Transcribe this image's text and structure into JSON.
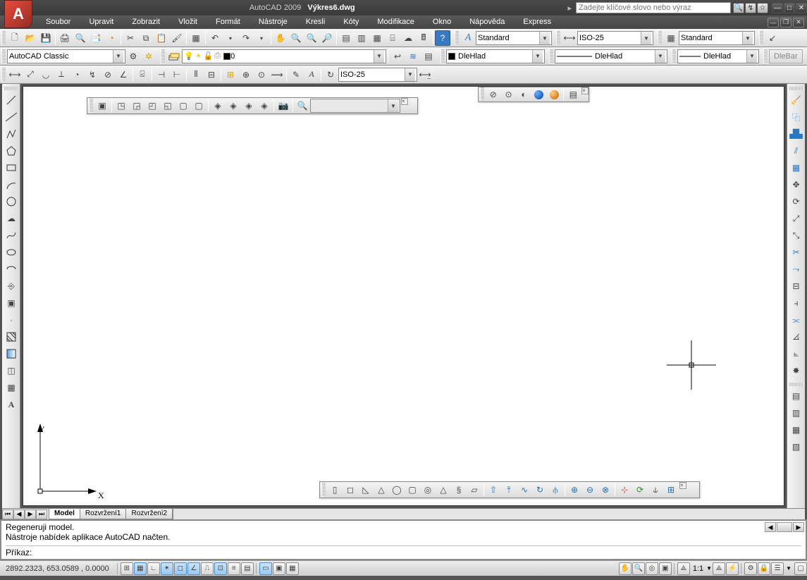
{
  "title": {
    "app": "AutoCAD 2009",
    "doc": "Výkres6.dwg"
  },
  "search_placeholder": "Zadejte klíčové slovo nebo výraz",
  "menu": [
    "Soubor",
    "Upravit",
    "Zobrazit",
    "Vložit",
    "Formát",
    "Nástroje",
    "Kresli",
    "Kóty",
    "Modifikace",
    "Okno",
    "Nápověda",
    "Express"
  ],
  "workspace_combo": "AutoCAD Classic",
  "layer_combo": " 0",
  "prop_combo_1": "DleHlad",
  "prop_combo_2": "DleHlad",
  "prop_combo_3": "DleHlad",
  "prop_btn": "DleBar",
  "textstyle": "Standard",
  "dimstyle": "ISO-25",
  "tablestyle": "Standard",
  "dimstyle2": "ISO-25",
  "tabs": {
    "active": "Model",
    "others": [
      "Rozvržení1",
      "Rozvržení2"
    ]
  },
  "cmd_lines": [
    "Regeneruji model.",
    "Nástroje nabídek aplikace AutoCAD načten.",
    "",
    "Příkaz:"
  ],
  "status_coords": "2892.2323, 653.0589 , 0.0000",
  "status_scale": "1:1",
  "ucs_x": "X",
  "ucs_y": "Y"
}
